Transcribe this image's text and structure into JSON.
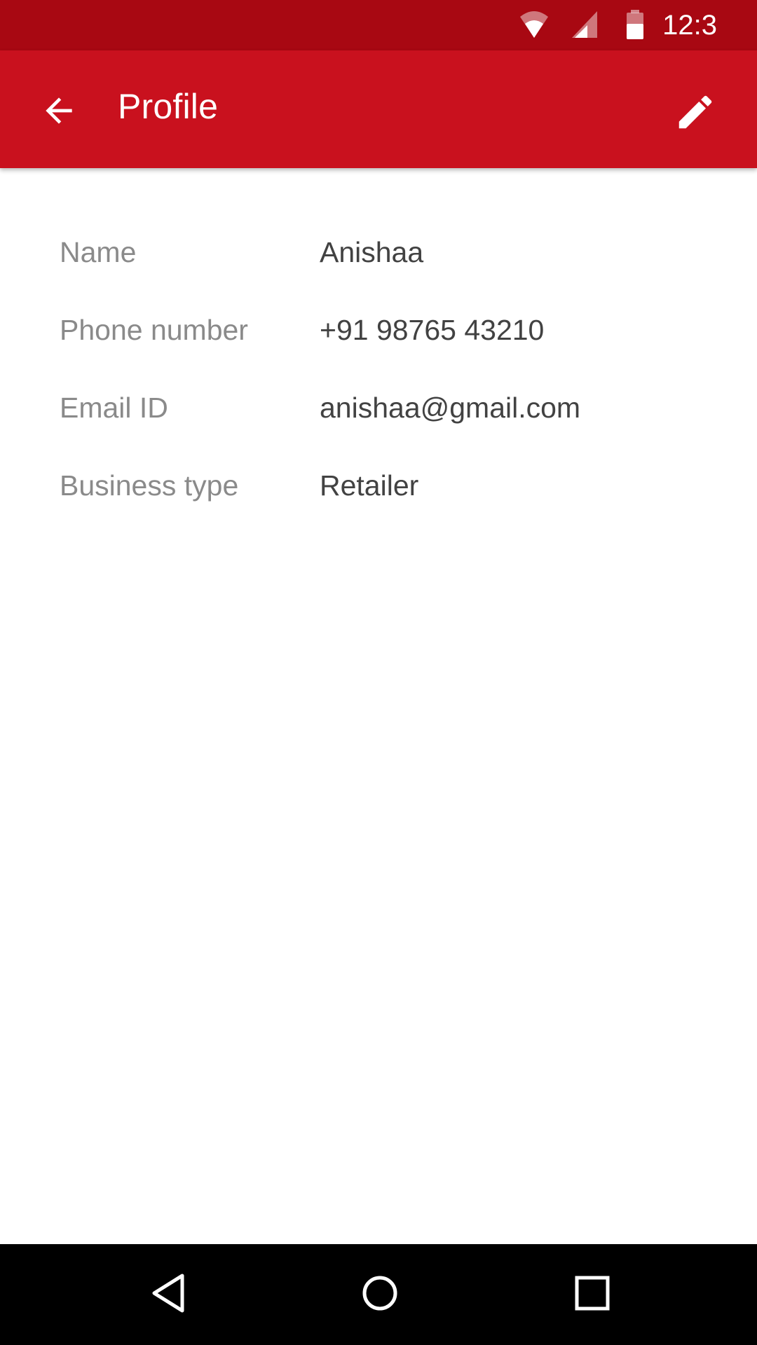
{
  "status_bar": {
    "time": "12:3",
    "icons": [
      "wifi-icon",
      "cell-signal-icon",
      "battery-icon"
    ]
  },
  "app_bar": {
    "title": "Profile",
    "back_icon": "arrow-back-icon",
    "edit_icon": "pencil-edit-icon",
    "color": "#c9111e",
    "status_color": "#a80812"
  },
  "profile": {
    "fields": [
      {
        "label": "Name",
        "value": "Anishaa"
      },
      {
        "label": "Phone number",
        "value": "+91 98765 43210"
      },
      {
        "label": "Email ID",
        "value": "anishaa@gmail.com"
      },
      {
        "label": "Business type",
        "value": "Retailer"
      }
    ]
  },
  "nav_bar": {
    "icons": [
      "nav-back-icon",
      "nav-home-icon",
      "nav-recents-icon"
    ]
  }
}
